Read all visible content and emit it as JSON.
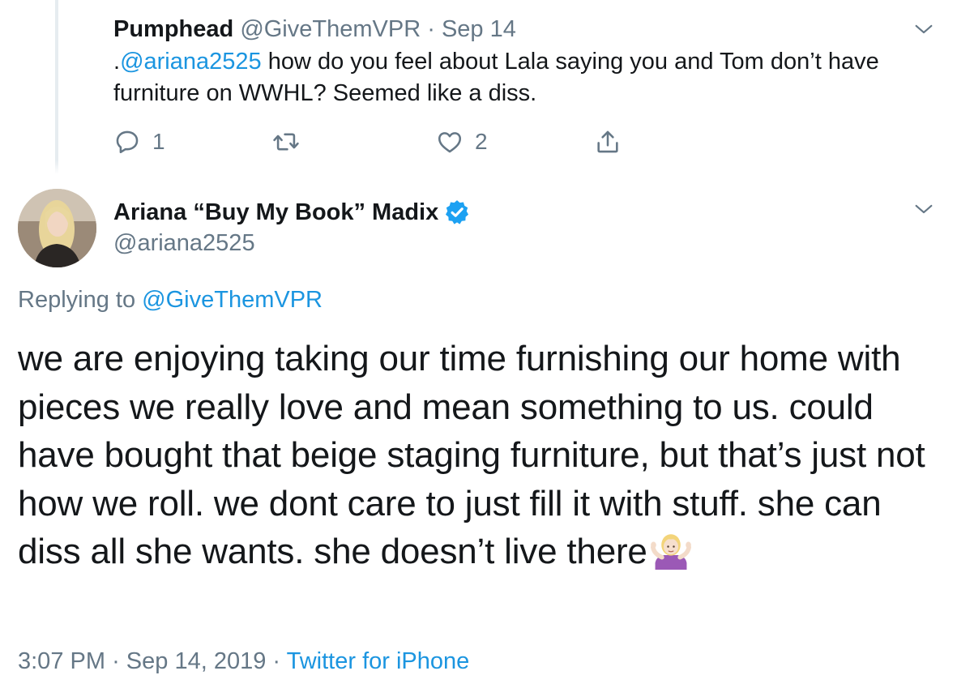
{
  "parent_tweet": {
    "name": "Pumphead",
    "handle": "@GiveThemVPR",
    "separator": "·",
    "date": "Sep 14",
    "text_prefix": ".",
    "mention": "@ariana2525",
    "text_rest": " how do you feel about Lala saying you and Tom don’t have furniture on WWHL? Seemed like a diss.",
    "reply_count": "1",
    "like_count": "2",
    "icons": {
      "reply": "reply-icon",
      "retweet": "retweet-icon",
      "like": "like-icon",
      "share": "share-icon",
      "menu": "chevron-down-icon"
    }
  },
  "main_tweet": {
    "name": "Ariana “Buy My Book” Madix",
    "handle": "@ariana2525",
    "verified": true,
    "replying_label": "Replying to ",
    "replying_handle": "@GiveThemVPR",
    "text": "we are enjoying taking our time furnishing our home with pieces we really love and mean something to us. could have bought that beige staging furniture, but that’s just not how we roll. we dont care to just fill it with stuff. she can diss all she wants. she doesn’t live there",
    "emoji": "person-shrugging-emoji",
    "time": "3:07 PM",
    "separator": "·",
    "date": "Sep 14, 2019",
    "source": "Twitter for iPhone"
  },
  "colors": {
    "text": "#14171a",
    "muted": "#657786",
    "link": "#1b95e0",
    "verified": "#1da1f2"
  }
}
